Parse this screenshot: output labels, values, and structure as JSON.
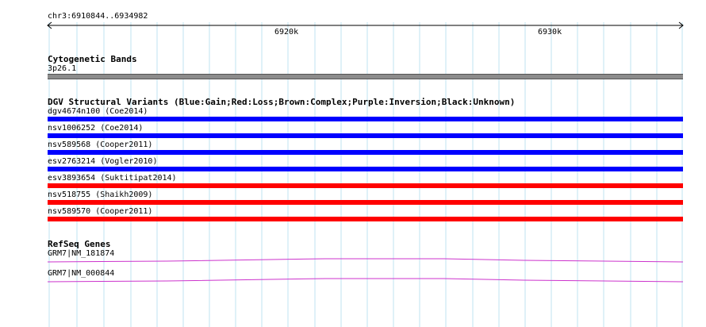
{
  "region": "chr3:6910844..6934982",
  "ticks": [
    "6920k",
    "6930k"
  ],
  "colors": {
    "grid": "#bfe3f2",
    "gain": "#0000ff",
    "loss": "#ff0000",
    "band": "#8c8c8c",
    "gene": "#cc33cc"
  },
  "cytoband": {
    "title": "Cytogenetic Bands",
    "band_label": "3p26.1"
  },
  "dgv": {
    "title": "DGV Structural Variants (Blue:Gain;Red:Loss;Brown:Complex;Purple:Inversion;Black:Unknown)",
    "variants": [
      {
        "label": "dgv4674n100 (Coe2014)",
        "type": "gain"
      },
      {
        "label": "nsv1006252 (Coe2014)",
        "type": "gain"
      },
      {
        "label": "nsv589568 (Cooper2011)",
        "type": "gain"
      },
      {
        "label": "esv2763214 (Vogler2010)",
        "type": "gain"
      },
      {
        "label": "esv3893654 (Suktitipat2014)",
        "type": "loss"
      },
      {
        "label": "nsv518755 (Shaikh2009)",
        "type": "loss"
      },
      {
        "label": "nsv589570 (Cooper2011)",
        "type": "loss"
      }
    ]
  },
  "refseq": {
    "title": "RefSeq Genes",
    "genes": [
      {
        "label": "GRM7|NM_181874"
      },
      {
        "label": "GRM7|NM_000844"
      }
    ]
  }
}
